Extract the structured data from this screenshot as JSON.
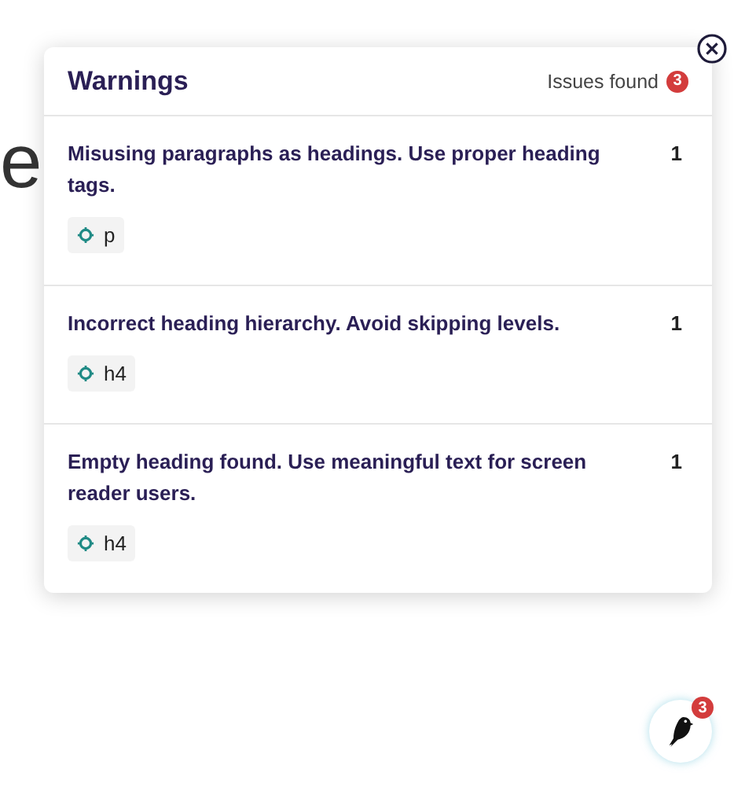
{
  "background_text": "e",
  "panel": {
    "title": "Warnings",
    "issues_label": "Issues found",
    "issues_count": "3"
  },
  "warnings": [
    {
      "message": "Misusing paragraphs as headings. Use proper heading tags.",
      "count": "1",
      "tag": "p"
    },
    {
      "message": "Incorrect heading hierarchy. Avoid skipping levels.",
      "count": "1",
      "tag": "h4"
    },
    {
      "message": "Empty heading found. Use meaningful text for screen reader users.",
      "count": "1",
      "tag": "h4"
    }
  ],
  "launcher": {
    "badge": "3"
  }
}
